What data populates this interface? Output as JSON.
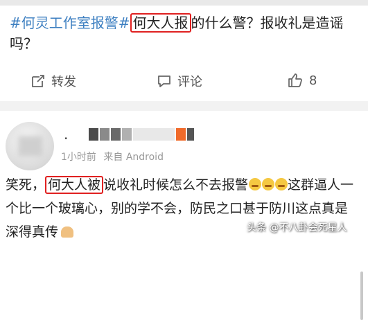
{
  "post": {
    "topic": "#何灵工作室报警#",
    "highlight": "何大人报",
    "rest": "的什么警？报收礼是造谣吗？"
  },
  "actions": {
    "repost_label": "转发",
    "comment_label": "评论",
    "like_count": "8"
  },
  "comment": {
    "username_prefix": ".",
    "time": "1小时前",
    "source": "来自 Android",
    "text_start": "笑死，",
    "highlight": "何大人被",
    "text_line1_rest": "说收礼时候怎么不去报警",
    "text_rest": "这群逼人一个比一个玻璃心，别的学不会，防民之口甚于防川这点真是深得真传"
  },
  "watermark": "头条 @不八卦会死星人",
  "colors": {
    "topic": "#3d7fc1",
    "highlight_box": "#e02020",
    "meta_gray": "#999999"
  }
}
